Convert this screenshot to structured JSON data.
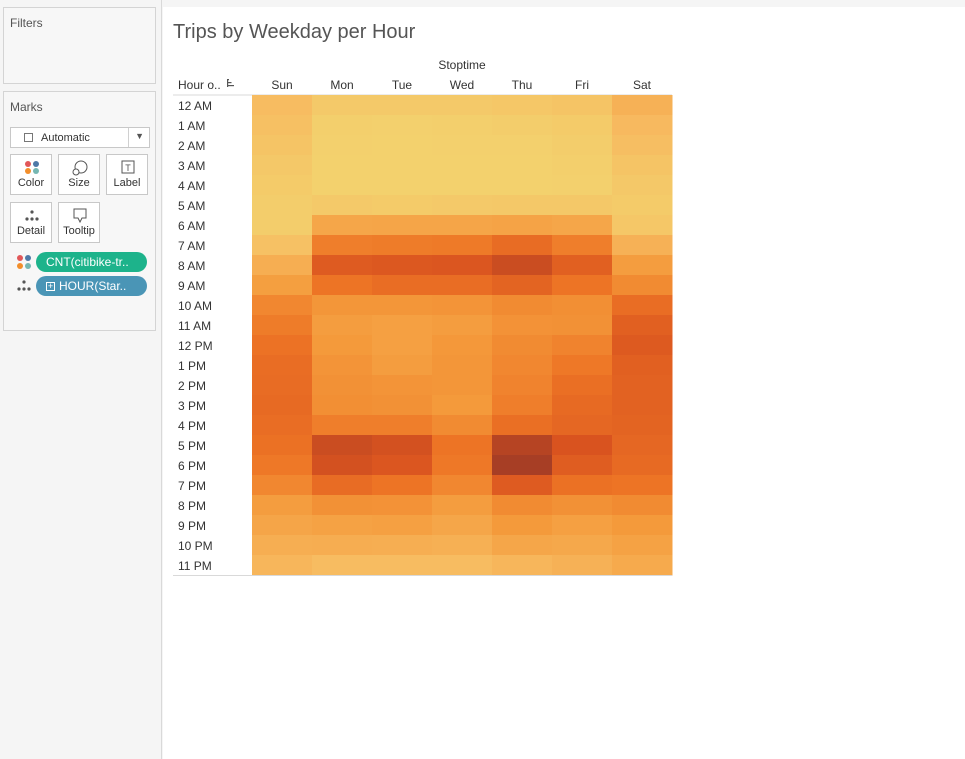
{
  "sidebar": {
    "filters_title": "Filters",
    "marks_title": "Marks",
    "mark_type": "Automatic",
    "buttons": {
      "color": "Color",
      "size": "Size",
      "label": "Label",
      "detail": "Detail",
      "tooltip": "Tooltip"
    },
    "pills": {
      "color_field": "CNT(citibike-tr..",
      "detail_field": "HOUR(Star.."
    }
  },
  "chart_data": {
    "type": "heatmap",
    "title": "Trips by Weekday per Hour",
    "column_header": "Stoptime",
    "row_header": "Hour o..",
    "columns": [
      "Sun",
      "Mon",
      "Tue",
      "Wed",
      "Thu",
      "Fri",
      "Sat"
    ],
    "rows": [
      "12 AM",
      "1 AM",
      "2 AM",
      "3 AM",
      "4 AM",
      "5 AM",
      "6 AM",
      "7 AM",
      "8 AM",
      "9 AM",
      "10 AM",
      "11 AM",
      "12 PM",
      "1 PM",
      "2 PM",
      "3 PM",
      "4 PM",
      "5 PM",
      "6 PM",
      "7 PM",
      "8 PM",
      "9 PM",
      "10 PM",
      "11 PM"
    ],
    "intensity": [
      [
        0.18,
        0.08,
        0.08,
        0.08,
        0.1,
        0.12,
        0.25
      ],
      [
        0.15,
        0.04,
        0.03,
        0.04,
        0.05,
        0.07,
        0.2
      ],
      [
        0.12,
        0.03,
        0.02,
        0.03,
        0.03,
        0.05,
        0.16
      ],
      [
        0.09,
        0.02,
        0.02,
        0.02,
        0.02,
        0.04,
        0.12
      ],
      [
        0.07,
        0.02,
        0.02,
        0.02,
        0.02,
        0.03,
        0.09
      ],
      [
        0.05,
        0.08,
        0.07,
        0.08,
        0.09,
        0.09,
        0.07
      ],
      [
        0.05,
        0.32,
        0.33,
        0.33,
        0.34,
        0.32,
        0.1
      ],
      [
        0.14,
        0.55,
        0.56,
        0.57,
        0.65,
        0.55,
        0.25
      ],
      [
        0.27,
        0.75,
        0.77,
        0.78,
        0.85,
        0.72,
        0.38
      ],
      [
        0.37,
        0.6,
        0.64,
        0.64,
        0.7,
        0.6,
        0.48
      ],
      [
        0.5,
        0.42,
        0.42,
        0.43,
        0.48,
        0.46,
        0.64
      ],
      [
        0.56,
        0.38,
        0.36,
        0.38,
        0.44,
        0.45,
        0.72
      ],
      [
        0.61,
        0.4,
        0.36,
        0.41,
        0.48,
        0.52,
        0.76
      ],
      [
        0.64,
        0.43,
        0.38,
        0.42,
        0.5,
        0.58,
        0.72
      ],
      [
        0.65,
        0.45,
        0.43,
        0.42,
        0.52,
        0.63,
        0.71
      ],
      [
        0.66,
        0.46,
        0.45,
        0.4,
        0.55,
        0.66,
        0.71
      ],
      [
        0.64,
        0.55,
        0.55,
        0.48,
        0.63,
        0.68,
        0.7
      ],
      [
        0.62,
        0.85,
        0.82,
        0.6,
        0.92,
        0.8,
        0.68
      ],
      [
        0.58,
        0.82,
        0.78,
        0.58,
        0.97,
        0.74,
        0.66
      ],
      [
        0.5,
        0.65,
        0.6,
        0.5,
        0.75,
        0.62,
        0.6
      ],
      [
        0.38,
        0.45,
        0.44,
        0.38,
        0.48,
        0.45,
        0.48
      ],
      [
        0.33,
        0.35,
        0.36,
        0.32,
        0.4,
        0.36,
        0.4
      ],
      [
        0.27,
        0.28,
        0.27,
        0.26,
        0.32,
        0.31,
        0.35
      ],
      [
        0.22,
        0.18,
        0.18,
        0.18,
        0.22,
        0.25,
        0.3
      ]
    ],
    "color_scale": [
      "#f2d46f",
      "#f7b95f",
      "#f49a3b",
      "#ed7425",
      "#d9531f",
      "#9e3a26"
    ]
  }
}
